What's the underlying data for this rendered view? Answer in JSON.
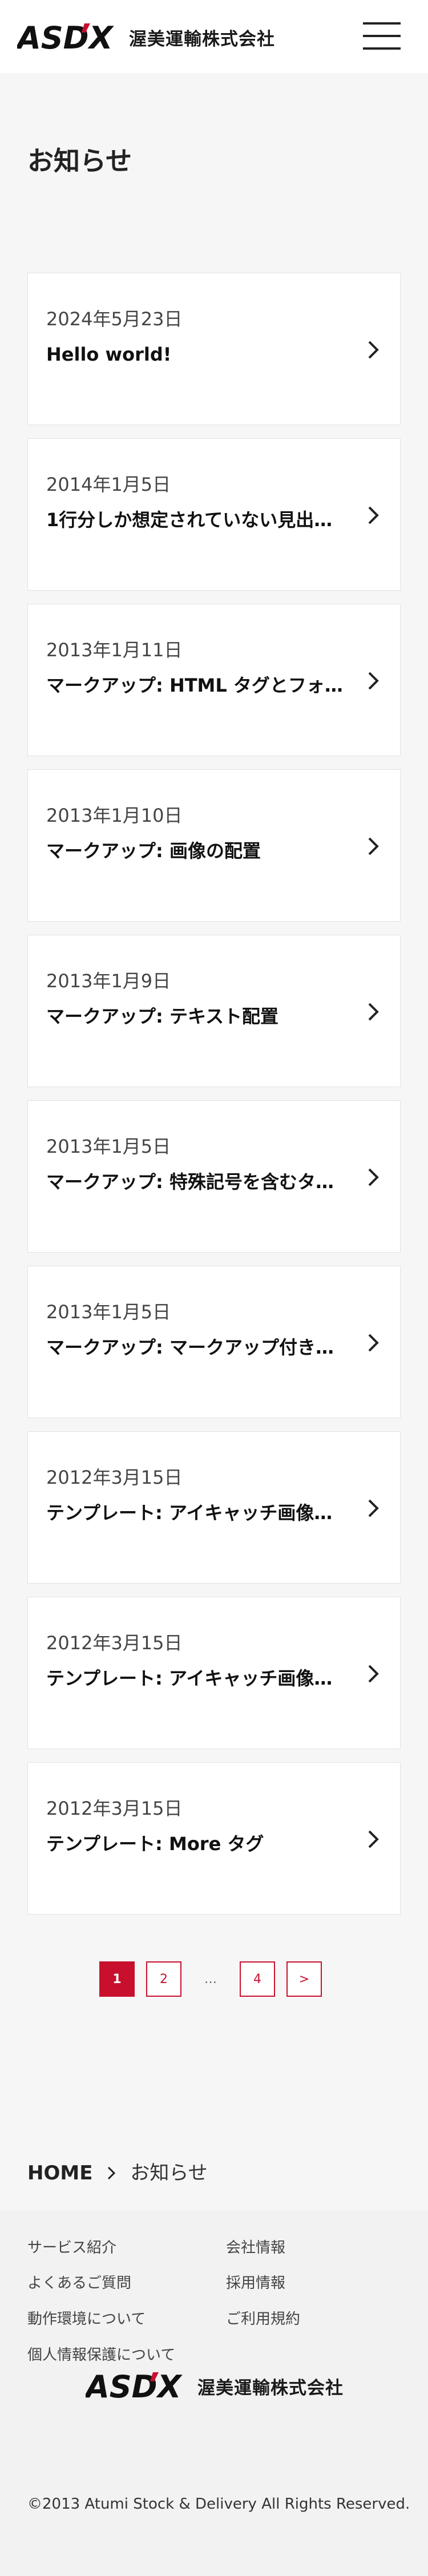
{
  "header": {
    "logo_text": "ASD'X",
    "company_name": "渥美運輸株式会社",
    "menu_icon": "hamburger-menu-icon"
  },
  "page": {
    "title": "お知らせ"
  },
  "posts": [
    {
      "date": "2024年5月23日",
      "title": "Hello world!"
    },
    {
      "date": "2014年1月5日",
      "title": "1行分しか想定されていない見出…"
    },
    {
      "date": "2013年1月11日",
      "title": "マークアップ: HTML タグとフォ…"
    },
    {
      "date": "2013年1月10日",
      "title": "マークアップ: 画像の配置"
    },
    {
      "date": "2013年1月9日",
      "title": "マークアップ: テキスト配置"
    },
    {
      "date": "2013年1月5日",
      "title": "マークアップ: 特殊記号を含むタ…"
    },
    {
      "date": "2013年1月5日",
      "title": "マークアップ: マークアップ付き…"
    },
    {
      "date": "2012年3月15日",
      "title": "テンプレート: アイキャッチ画像…"
    },
    {
      "date": "2012年3月15日",
      "title": "テンプレート: アイキャッチ画像…"
    },
    {
      "date": "2012年3月15日",
      "title": "テンプレート: More タグ"
    }
  ],
  "pagination": {
    "current": "1",
    "page2": "2",
    "ellipsis": "…",
    "page4": "4",
    "next": ">"
  },
  "breadcrumb": {
    "home": "HOME",
    "current": "お知らせ"
  },
  "footer": {
    "links_left": [
      "サービス紹介",
      "よくあるご質問",
      "動作環境について",
      "個人情報保護について"
    ],
    "links_right": [
      "会社情報",
      "採用情報",
      "ご利用規約"
    ],
    "logo_text": "ASD'X",
    "company_name": "渥美運輸株式会社",
    "copyright": "©2013 Atumi Stock & Delivery All Rights Reserved."
  },
  "colors": {
    "accent": "#c8102e",
    "background": "#f6f6f6"
  }
}
